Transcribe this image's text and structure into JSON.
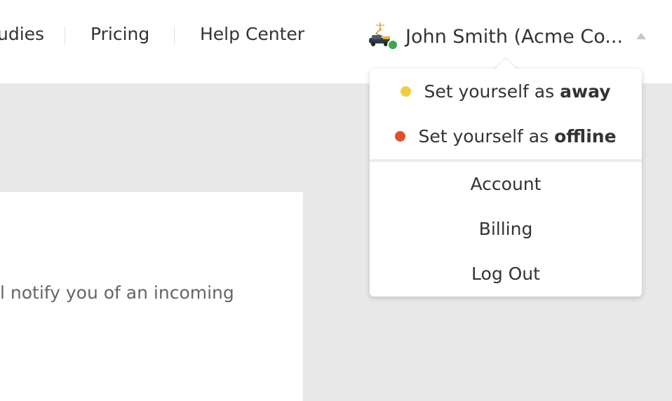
{
  "nav": {
    "items": [
      {
        "label": "udies"
      },
      {
        "label": "Pricing"
      },
      {
        "label": "Help Center"
      }
    ]
  },
  "user": {
    "name": "John Smith (Acme Co...",
    "status_color": "#3ba551",
    "avatar_icon": "lamp-car-icon"
  },
  "dropdown": {
    "status_items": [
      {
        "prefix": "Set yourself as",
        "state": "away",
        "color": "#f3cc3c"
      },
      {
        "prefix": "Set yourself as",
        "state": "offline",
        "color": "#e0502a"
      }
    ],
    "menu_items": [
      {
        "label": "Account"
      },
      {
        "label": "Billing"
      },
      {
        "label": "Log Out"
      }
    ]
  },
  "content": {
    "text": "l notify you of an incoming"
  }
}
